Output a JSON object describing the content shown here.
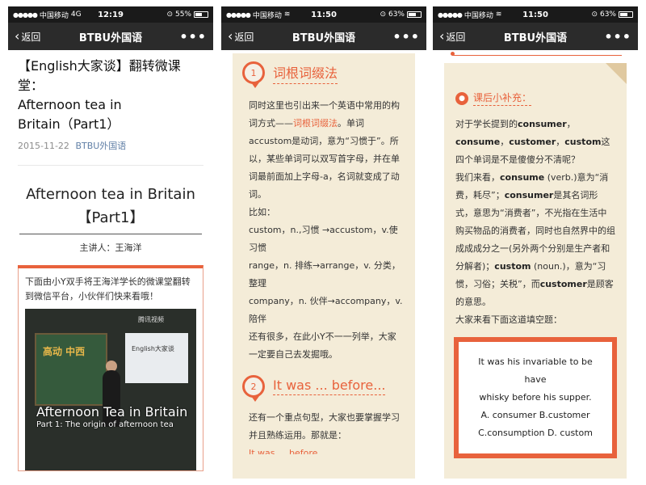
{
  "phones": [
    {
      "status": {
        "carrier": "中国移动",
        "network": "4G",
        "time": "12:19",
        "battery": "55%",
        "battery_level": 0.55
      },
      "nav": {
        "back": "返回",
        "title": "BTBU外国语",
        "more": "•••"
      },
      "article": {
        "title_lines": [
          "【English大家谈】翻转微课堂：",
          "Afternoon tea in",
          "Britain（Part1）"
        ],
        "date": "2015-11-22",
        "source": "BTBU外国语",
        "subject_line1": "Afternoon tea in Britain",
        "subject_line2": "【Part1】",
        "lecturer": "主讲人：王海洋",
        "intro": "下面由小Y双手将王海洋学长的微课堂翻转到微信平台，小伙伴们快来看哦！",
        "video": {
          "title": "Afternoon Tea in Britain",
          "subtitle": "Part 1: The origin of afternoon tea",
          "board_text": "高动 中西",
          "screen_text": "English大家谈",
          "logo": "腾讯视频"
        }
      }
    },
    {
      "status": {
        "carrier": "中国移动",
        "network": "wifi",
        "time": "11:50",
        "battery": "63%",
        "battery_level": 0.63
      },
      "nav": {
        "back": "返回",
        "title": "BTBU外国语",
        "more": "•••"
      },
      "section1": {
        "number": "1",
        "title": "词根词缀法"
      },
      "para": {
        "intro_a": "同时这里也引出来一个英语中常用的构词方式——",
        "intro_hl": "词根词缀法",
        "intro_b": "。单词accustom是动词，意为“习惯于”。所以，某些单词可以双写首字母，并在单词最前面加上字母-a，名词就变成了动词。",
        "example_label": "比如：",
        "ex1": "custom，n.,习惯 →accustom，v.使习惯",
        "ex2": "range，n. 排练→arrange，v. 分类，整理",
        "ex3": "company，n. 伙伴→accompany，v.陪伴",
        "outro": "还有很多，在此小Y不一一列举，大家一定要自己去发掘哦。"
      },
      "section2": {
        "number": "2",
        "title": "It was ... before..."
      },
      "para2": {
        "text": "还有一个重点句型，大家也要掌握学习并且熟练运用。那就是：",
        "cut": "It was ... before..."
      }
    },
    {
      "status": {
        "carrier": "中国移动",
        "network": "wifi",
        "time": "11:50",
        "battery": "63%",
        "battery_level": 0.63
      },
      "nav": {
        "back": "返回",
        "title": "BTBU外国语",
        "more": "•••"
      },
      "tip": {
        "title": "课后小补充："
      },
      "content": {
        "q_a": "对于学长提到的",
        "q_b1": "consumer",
        "q_c": "，",
        "q_b2": "consume",
        "q_d": "，",
        "q_b3": "customer",
        "q_e": "，",
        "q_b4": "custom",
        "q_f": "这四个单词是不是傻傻分不清呢？",
        "l_a": "我们来看，",
        "l_b1": "consume",
        "l_c": " (verb.)意为“消费，耗尽”；",
        "l_b2": "consumer",
        "l_d": "是其名词形式，意思为“消费者”，不光指在生活中购买物品的消费者，同时也自然界中的组成成成分之一(另外两个分别是生产者和分解者)；",
        "l_b3": "custom",
        "l_e": " (noun.)，意为“习惯，习俗；关税”，而",
        "l_b4": "customer",
        "l_f": "是顾客的意思。",
        "fill": "大家来看下面这道填空题："
      },
      "quiz": {
        "line1": "It was his invariable to be have",
        "line2": "whisky before his supper.",
        "line3": "A. consumer B.customer",
        "line4": "C.consumption D. custom"
      }
    }
  ]
}
